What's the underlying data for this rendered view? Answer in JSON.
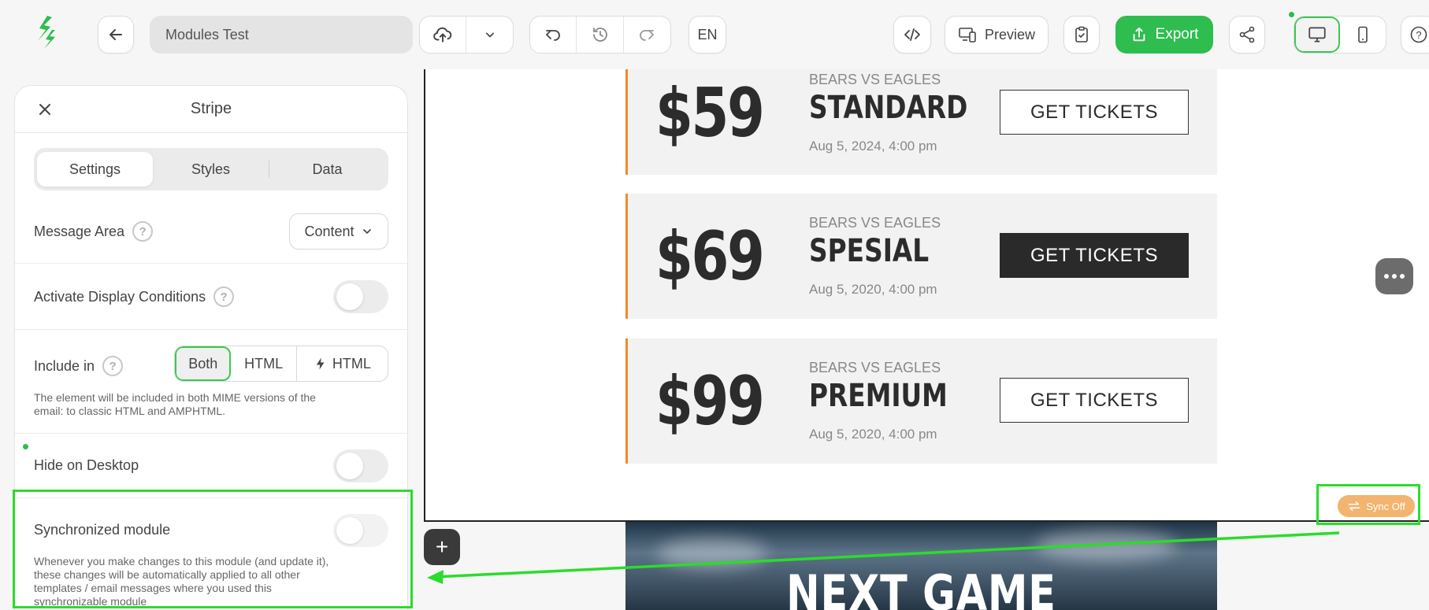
{
  "toolbar": {
    "template_name": "Modules Test",
    "language": "EN",
    "preview_label": "Preview",
    "export_label": "Export"
  },
  "panel": {
    "title": "Stripe",
    "tabs": [
      "Settings",
      "Styles",
      "Data"
    ],
    "message_area": {
      "label": "Message Area",
      "value": "Content"
    },
    "display_conditions": {
      "label": "Activate Display Conditions",
      "enabled": false
    },
    "include_in": {
      "label": "Include in",
      "options": [
        "Both",
        "HTML",
        "HTML"
      ],
      "selected": "Both",
      "hint_line1": "The element will be included in both MIME versions of the",
      "hint_line2": "email: to classic HTML and AMPHTML."
    },
    "hide_desktop": {
      "label": "Hide on Desktop",
      "enabled": false
    },
    "sync_module": {
      "label": "Synchronized module",
      "enabled": false,
      "hint_line1": "Whenever you make changes to this module (and update it),",
      "hint_line2": "these changes will be automatically applied to all other",
      "hint_line3": "templates / email messages where you used this",
      "hint_line4": "synchronizable module"
    }
  },
  "tickets": [
    {
      "price": "$59",
      "matchup": "BEARS VS EAGLES",
      "tier": "STANDARD",
      "date": "Aug 5, 2024, 4:00 pm",
      "cta": "GET TICKETS"
    },
    {
      "price": "$69",
      "matchup": "BEARS VS EAGLES",
      "tier": "SPESIAL",
      "date": "Aug 5, 2020, 4:00 pm",
      "cta": "GET TICKETS"
    },
    {
      "price": "$99",
      "matchup": "BEARS VS EAGLES",
      "tier": "PREMIUM",
      "date": "Aug 5, 2020, 4:00 pm",
      "cta": "GET TICKETS"
    }
  ],
  "hero": {
    "title": "NEXT GAME"
  },
  "sync_badge": "Sync Off",
  "colors": {
    "accent_green": "#2ebd4e",
    "highlight_green": "#2bdc2b",
    "ticket_border": "#f08a2b",
    "sync_badge": "#f2b46e"
  },
  "icons": [
    "logo-icon",
    "back-arrow-icon",
    "cloud-upload-icon",
    "chevron-down-icon",
    "undo-icon",
    "history-icon",
    "redo-icon",
    "code-icon",
    "devices-icon",
    "clipboard-check-icon",
    "export-icon",
    "share-icon",
    "desktop-icon",
    "mobile-icon",
    "help-icon",
    "close-icon",
    "lightning-icon",
    "plus-icon",
    "more-icon",
    "sync-icon"
  ]
}
